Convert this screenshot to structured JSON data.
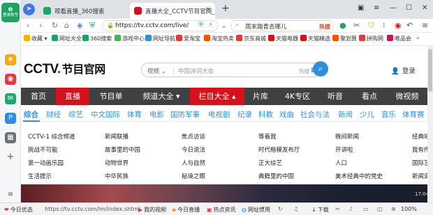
{
  "sidebar": {
    "logo_top": "登录账号",
    "items": [
      "collect",
      "weibo",
      "mail",
      "pay",
      "apps",
      "add"
    ]
  },
  "tabs": [
    {
      "label": "观看直播_360搜索",
      "active": false
    },
    {
      "label": "直播大全_CCTV节目官网_央",
      "active": true
    }
  ],
  "address": {
    "url": "https://tv.cctv.com/live/",
    "search_value": "周末踏青去哪儿",
    "hot_label": "热搜"
  },
  "bookmarks": [
    "收藏",
    "网址大全",
    "360搜索",
    "游戏中心",
    "网址导航",
    "爱淘宝",
    "淘宝热卖",
    "京东商城",
    "天猫电器",
    "天猫精选",
    "聚划算",
    "拼购网",
    "唯品会"
  ],
  "site": {
    "logo_main": "CCTV",
    "logo_dot": ".",
    "logo_sub": "节目官网",
    "search_category": "视频",
    "search_placeholder": "中国诗词大会",
    "hot_label": "热搜",
    "login_label": "登录"
  },
  "main_nav": [
    "首页",
    "直播",
    "节目单",
    "频道大全 ▾",
    "栏目大全 ▴",
    "片库",
    "4K专区",
    "听音",
    "看点",
    "微视频"
  ],
  "sub_nav": [
    "综合",
    "财经",
    "综艺",
    "中文国际",
    "体育",
    "电影",
    "国防军事",
    "电视剧",
    "纪录",
    "科教",
    "戏曲",
    "社会与法",
    "新闻",
    "少儿",
    "音乐",
    "体育赛"
  ],
  "program_links": [
    [
      "CCTV-1 综合频道",
      "新闻联播",
      "焦点访谈",
      "等着我",
      "晚间新闻",
      "经典咏"
    ],
    [
      "挑战不可能",
      "故事里的中国",
      "今日说法",
      "时代楷模发布厅",
      "开讲啦",
      "我有传"
    ],
    [
      "第一动画乐园",
      "动物世界",
      "人与自然",
      "正大综艺",
      "人口",
      "国际艺"
    ],
    [
      "生活提示",
      "中华民族",
      "秘境之眼",
      "典籍里的中国",
      "美术经典中的党史",
      "新闻调"
    ]
  ],
  "hero": {
    "corner_label": "17:04"
  },
  "status": {
    "left_label": "今日优选",
    "url": "https://tv.cctv.com/lm/index.shtml",
    "items": [
      "我的视频",
      "今日直播",
      "热点资讯",
      "网址惯用",
      "下载",
      "100%"
    ]
  },
  "colors": {
    "cctv_red": "#d6111b",
    "nav_dark": "#3e4042",
    "accent_blue": "#2f8fdd",
    "browser_green": "#1da462"
  }
}
